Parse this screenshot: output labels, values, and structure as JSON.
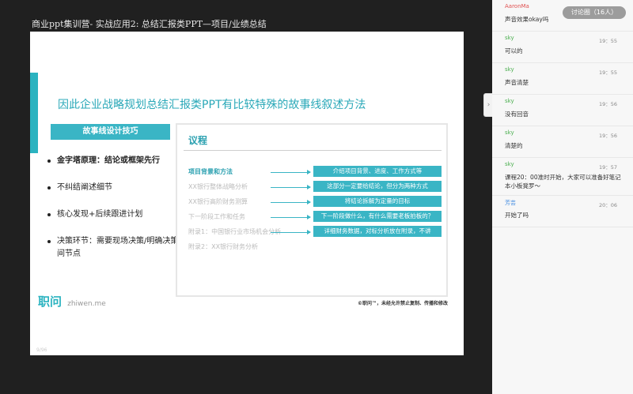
{
  "video": {
    "title": "商业ppt集训营-  实战应用2: 总结汇报类PPT—项目/业绩总结",
    "page_number": "9/96"
  },
  "slide": {
    "headline": "因此企业战略规划总结汇报类PPT有比较特殊的故事线叙述方法",
    "technique_label": "故事线设计技巧",
    "bullets": [
      "金字塔原理：结论或框架先行",
      "不纠结阐述细节",
      "核心发现+后续跟进计划",
      "决策环节：需要现场决策/明确决策时间节点"
    ],
    "agenda": {
      "title": "议程",
      "items": [
        {
          "label": "项目背景和方法",
          "desc": "介绍项目背景、进度、工作方式等"
        },
        {
          "label": "XX银行整体战略分析",
          "desc": "这部分一定要给结论，但分为两种方式"
        },
        {
          "label": "XX银行高阶财务测算",
          "desc": "将结论拆解为定量的目标"
        },
        {
          "label": "下一阶段工作和任务",
          "desc": "下一阶段做什么，有什么需要老板拍板的？"
        },
        {
          "label": "附录1：中国银行业市场机会分析",
          "desc": "详细财务数据，对标分析放在附录，不讲"
        },
        {
          "label": "附录2：XX银行财务分析",
          "desc": ""
        }
      ]
    },
    "copyright": "©职问™，未经允许禁止复制、传播和修改",
    "logo": {
      "mark": "职问",
      "url": "zhiwen.me"
    }
  },
  "discussion": {
    "label": "讨论圈（16人）"
  },
  "chat": [
    {
      "user": "AaronMa",
      "time": "",
      "text": "声音效果okay吗"
    },
    {
      "user": "sky",
      "time": "19：55",
      "text": "可以的"
    },
    {
      "user": "sky",
      "time": "19：55",
      "text": "声音清楚"
    },
    {
      "user": "sky",
      "time": "19：56",
      "text": "没有回音"
    },
    {
      "user": "sky",
      "time": "19：56",
      "text": "清楚的"
    },
    {
      "user": "sky",
      "time": "19：57",
      "text": "课程20：00准时开始，大家可以准备好笔记本小板凳罗～"
    },
    {
      "user": "芳芸",
      "time": "20：06",
      "text": "开始了吗"
    }
  ],
  "colors": {
    "accent": "#3ab5c5"
  },
  "icons": {
    "collapse": "chevron-right-icon"
  }
}
